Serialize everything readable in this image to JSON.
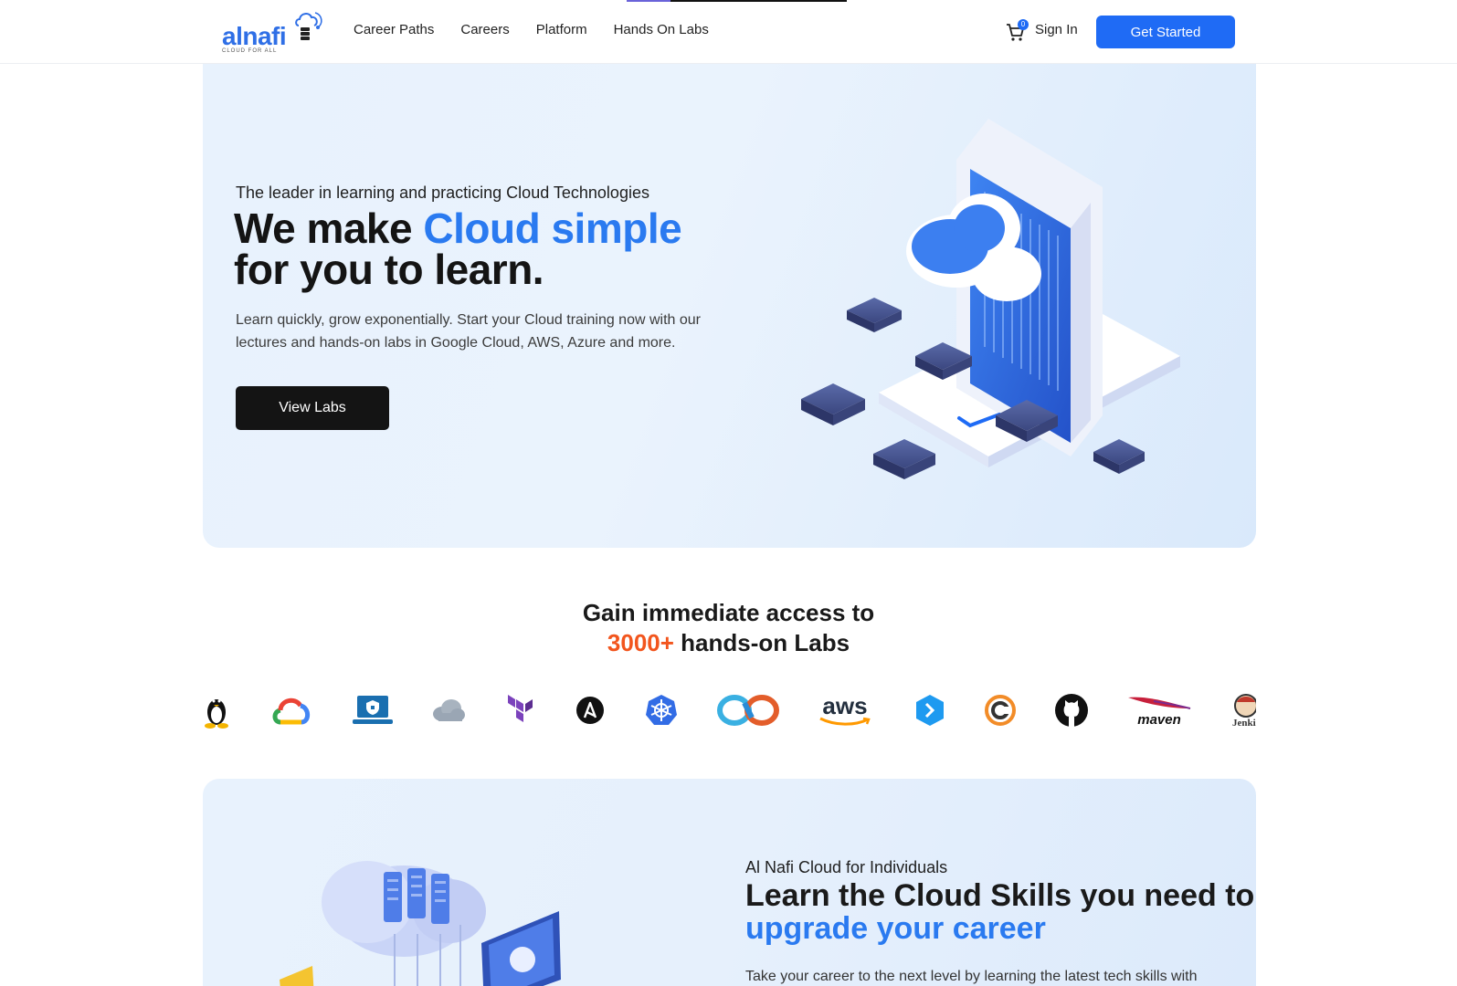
{
  "brand": {
    "name": "alnafi",
    "tagline": "CLOUD FOR ALL"
  },
  "nav": {
    "items": [
      {
        "label": "Career Paths"
      },
      {
        "label": "Careers"
      },
      {
        "label": "Platform"
      },
      {
        "label": "Hands On Labs"
      }
    ],
    "cart_count": "0",
    "sign_in": "Sign In",
    "get_started": "Get Started"
  },
  "hero": {
    "kicker": "The leader in learning and practicing Cloud Technologies",
    "title_part1": "We make ",
    "title_accent": "Cloud simple",
    "title_part2": "for you to learn.",
    "description": "Learn quickly, grow exponentially. Start your Cloud training now with our lectures and hands-on labs in Google Cloud, AWS, Azure and more.",
    "cta": "View Labs"
  },
  "access": {
    "line1": "Gain immediate access to",
    "count": "3000+",
    "line2_rest": " hands-on Labs"
  },
  "tools": [
    {
      "icon": "linux-icon"
    },
    {
      "icon": "google-cloud-icon"
    },
    {
      "icon": "laptop-security-icon"
    },
    {
      "icon": "cloud-icon"
    },
    {
      "icon": "terraform-icon"
    },
    {
      "icon": "ansible-icon"
    },
    {
      "icon": "kubernetes-icon"
    },
    {
      "icon": "devops-infinity-icon"
    },
    {
      "icon": "aws-icon",
      "text": "aws"
    },
    {
      "icon": "azure-devops-icon"
    },
    {
      "icon": "circleci-icon"
    },
    {
      "icon": "github-icon"
    },
    {
      "icon": "maven-icon",
      "text": "maven"
    },
    {
      "icon": "jenkins-icon",
      "text": "Jenkins"
    }
  ],
  "section2": {
    "kicker": "Al Nafi Cloud for Individuals",
    "title_part1": "Learn the Cloud Skills you need to ",
    "title_accent": "upgrade your career",
    "description": "Take your career to the next level by learning the latest tech skills with"
  },
  "colors": {
    "accent": "#2a7af0",
    "primary_button": "#1f6bf5",
    "dark_button": "#141414",
    "highlight": "#f2551d"
  }
}
